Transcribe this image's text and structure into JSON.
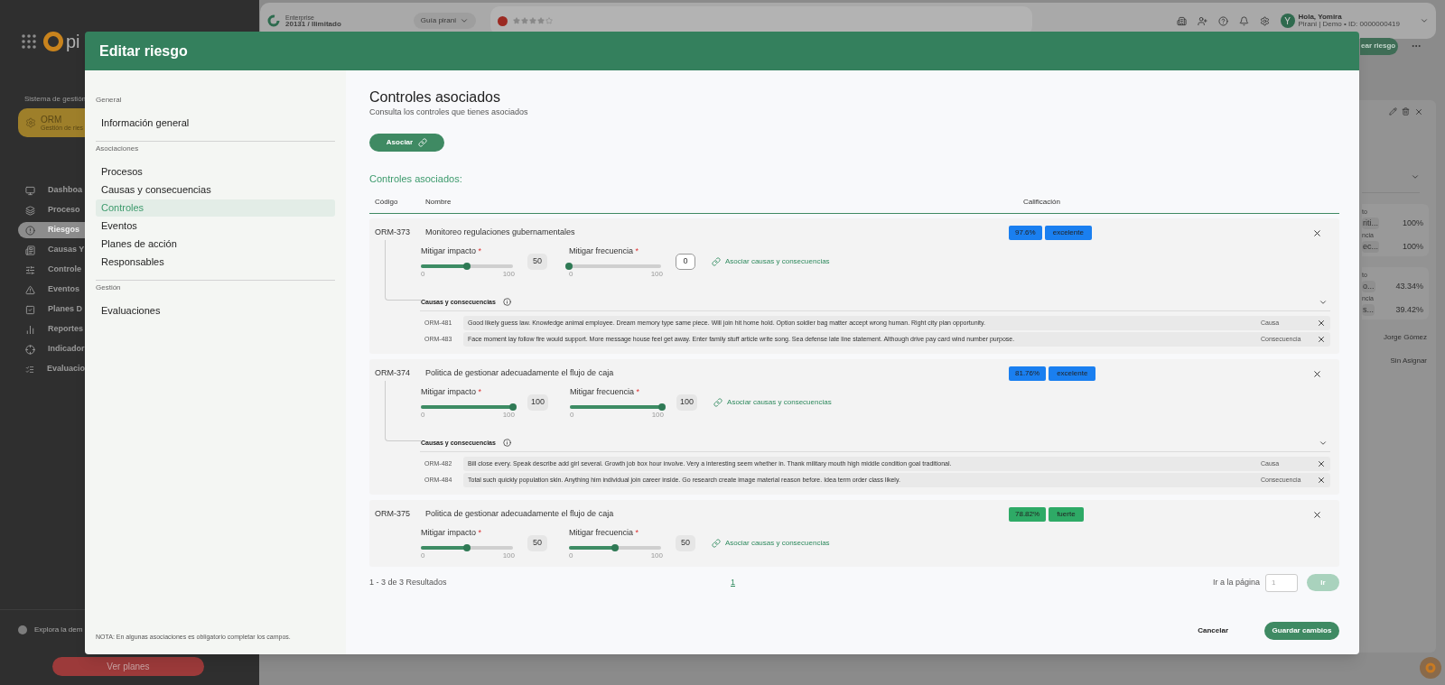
{
  "background": {
    "logo_text": "pi",
    "system_label": "Sistema de gestión",
    "system": {
      "title": "ORM",
      "subtitle": "Gestión de ries"
    },
    "nav": [
      {
        "label": "Dashboa",
        "selected": false
      },
      {
        "label": "Proceso",
        "selected": false
      },
      {
        "label": "Riesgos",
        "selected": true
      },
      {
        "label": "Causas Y",
        "selected": false
      },
      {
        "label": "Controle",
        "selected": false
      },
      {
        "label": "Eventos",
        "selected": false
      },
      {
        "label": "Planes D",
        "selected": false
      },
      {
        "label": "Reportes",
        "selected": false
      },
      {
        "label": "Indicador",
        "selected": false
      },
      {
        "label": "Evaluacio",
        "selected": false
      }
    ],
    "demo_label": "Explora la dem",
    "plans_button": "Ver planes",
    "topbar": {
      "plan": "Enterprise",
      "plan_detail": "20131 / Ilimitado",
      "guide": "Guía pirani",
      "stars": 4,
      "avatar": "Y",
      "greeting": "Hola, Yomira",
      "account": "Pirani | Demo • ID: 0000000419"
    },
    "create_button": "ear riesgo",
    "side_panel": {
      "groups": [
        {
          "rows": [
            {
              "label": "to",
              "chip": "riti...",
              "value": "100%"
            },
            {
              "label": "ncia",
              "chip": "ec...",
              "value": "100%"
            }
          ]
        },
        {
          "rows": [
            {
              "label": "to",
              "chip": "o...",
              "value": "43.34%"
            },
            {
              "label": "ncia",
              "chip": "s...",
              "value": "39.42%"
            }
          ]
        }
      ],
      "people": [
        "Jorge Gómez",
        "Sin Asignar"
      ]
    }
  },
  "modal": {
    "title": "Editar riesgo",
    "nav_sections": [
      {
        "title": "General",
        "items": [
          {
            "label": "Información general",
            "selected": false
          }
        ]
      },
      {
        "title": "Asociaciones",
        "items": [
          {
            "label": "Procesos",
            "selected": false
          },
          {
            "label": "Causas y consecuencias",
            "selected": false
          },
          {
            "label": "Controles",
            "selected": true
          },
          {
            "label": "Eventos",
            "selected": false
          },
          {
            "label": "Planes de acción",
            "selected": false
          },
          {
            "label": "Responsables",
            "selected": false
          }
        ]
      },
      {
        "title": "Gestión",
        "items": [
          {
            "label": "Evaluaciones",
            "selected": false
          }
        ]
      }
    ],
    "note": "NOTA: En algunas asociaciones es obligatorio completar los campos.",
    "heading": "Controles asociados",
    "subheading": "Consulta los controles que tienes asociados",
    "associate_button": "Asociar",
    "list_title": "Controles asociados:",
    "columns": [
      "Código",
      "Nombre",
      "Calificación"
    ],
    "controls": [
      {
        "code": "ORM-373",
        "name": "Monitoreo regulaciones gubernamentales",
        "score": "97.6%",
        "rating": "excelente",
        "color": "#1a7ff0",
        "sliders": [
          {
            "label": "Mitigar impacto",
            "required_mark": "*",
            "level": 0.5,
            "value": "50",
            "focused": false,
            "min": "0",
            "max": "100"
          },
          {
            "label": "Mitigar frecuencia",
            "required_mark": "*",
            "level": 0,
            "value": "0",
            "focused": true,
            "min": "0",
            "max": "100"
          }
        ],
        "link": "Asociar causas y consecuencias",
        "causes_title": "Causas y consecuencias",
        "causes": [
          {
            "code": "ORM-481",
            "text": "Good likely guess law. Knowledge animal employee. Dream memory type same piece. Will join hit home hold. Option soldier bag matter accept wrong human. Right city plan opportunity.",
            "type": "Causa"
          },
          {
            "code": "ORM-483",
            "text": "Face moment lay follow fire would support. More message house feel get away. Enter family stuff article write song. Sea defense late line statement. Although drive pay card wind number purpose.",
            "type": "Consecuencia"
          }
        ]
      },
      {
        "code": "ORM-374",
        "name": "Politica de gestionar adecuadamente el flujo de caja",
        "score": "81.76%",
        "rating": "excelente",
        "color": "#1a7ff0",
        "sliders": [
          {
            "label": "Mitigar impacto",
            "required_mark": "*",
            "level": 1,
            "value": "100",
            "focused": false,
            "min": "0",
            "max": "100"
          },
          {
            "label": "Mitigar frecuencia",
            "required_mark": "*",
            "level": 1,
            "value": "100",
            "focused": false,
            "min": "0",
            "max": "100"
          }
        ],
        "link": "Asociar causas y consecuencias",
        "causes_title": "Causas y consecuencias",
        "causes": [
          {
            "code": "ORM-482",
            "text": "Bill close every. Speak describe add girl several. Growth job box hour involve. Very a interesting seem whether in. Thank military mouth high middle condition goal traditional.",
            "type": "Causa"
          },
          {
            "code": "ORM-484",
            "text": "Total such quickly population skin. Anything him individual join career inside. Go research create image material reason before. Idea term order class likely.",
            "type": "Consecuencia"
          }
        ]
      },
      {
        "code": "ORM-375",
        "name": "Politica de gestionar adecuadamente el flujo de caja",
        "score": "78.82%",
        "rating": "fuerte",
        "color": "#2eaa66",
        "sliders": [
          {
            "label": "Mitigar impacto",
            "required_mark": "*",
            "level": 0.5,
            "value": "50",
            "focused": false,
            "min": "0",
            "max": "100"
          },
          {
            "label": "Mitigar frecuencia",
            "required_mark": "*",
            "level": 0.5,
            "value": "50",
            "focused": false,
            "min": "0",
            "max": "100"
          }
        ],
        "link": "Asociar causas y consecuencias"
      }
    ],
    "pagination": {
      "summary": "1 - 3 de 3 Resultados",
      "pages": [
        {
          "label": "1",
          "selected": true
        }
      ],
      "goto_label": "Ir a la página",
      "goto_placeholder": "1",
      "goto_button": "Ir",
      "goto_disabled": true
    },
    "cancel_button": "Cancelar",
    "save_button": "Guardar cambios"
  }
}
